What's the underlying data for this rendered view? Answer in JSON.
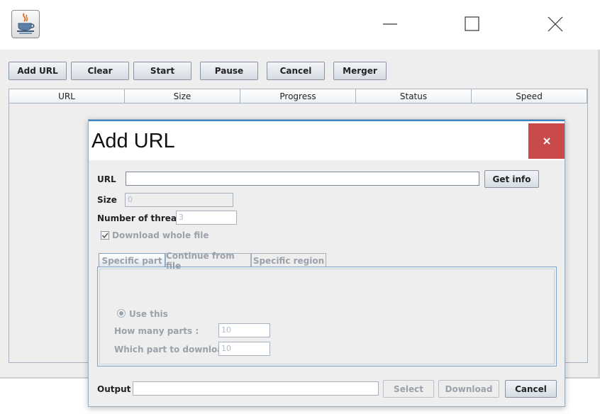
{
  "toolbar": {
    "add_url": "Add URL",
    "clear": "Clear",
    "start": "Start",
    "pause": "Pause",
    "cancel": "Cancel",
    "merger": "Merger"
  },
  "table": {
    "columns": [
      "URL",
      "Size",
      "Progress",
      "Status",
      "Speed"
    ]
  },
  "dialog": {
    "title": "Add URL",
    "url_label": "URL",
    "url_value": "",
    "get_info": "Get info",
    "size_label": "Size",
    "size_value": "0",
    "threads_label": "Number of threads",
    "threads_value": "3",
    "download_whole_file": "Download whole file",
    "download_whole_file_checked": true,
    "tabs": [
      "Specific part",
      "Continue from file",
      "Specific region"
    ],
    "selected_tab": "Specific part",
    "use_this": "Use this",
    "how_many_parts_label": "How many parts :",
    "how_many_parts_value": "10",
    "which_part_label": "Which part to download :",
    "which_part_value": "10",
    "output_label": "Output",
    "output_value": "",
    "select": "Select",
    "download": "Download",
    "cancel": "Cancel"
  },
  "icons": {
    "app": "java-coffee-cup-icon",
    "minimize": "minimize-icon",
    "maximize": "maximize-icon",
    "close": "close-icon"
  },
  "colors": {
    "dialog_close_bg": "#c94a4a",
    "accent_border": "#3d86c6"
  }
}
